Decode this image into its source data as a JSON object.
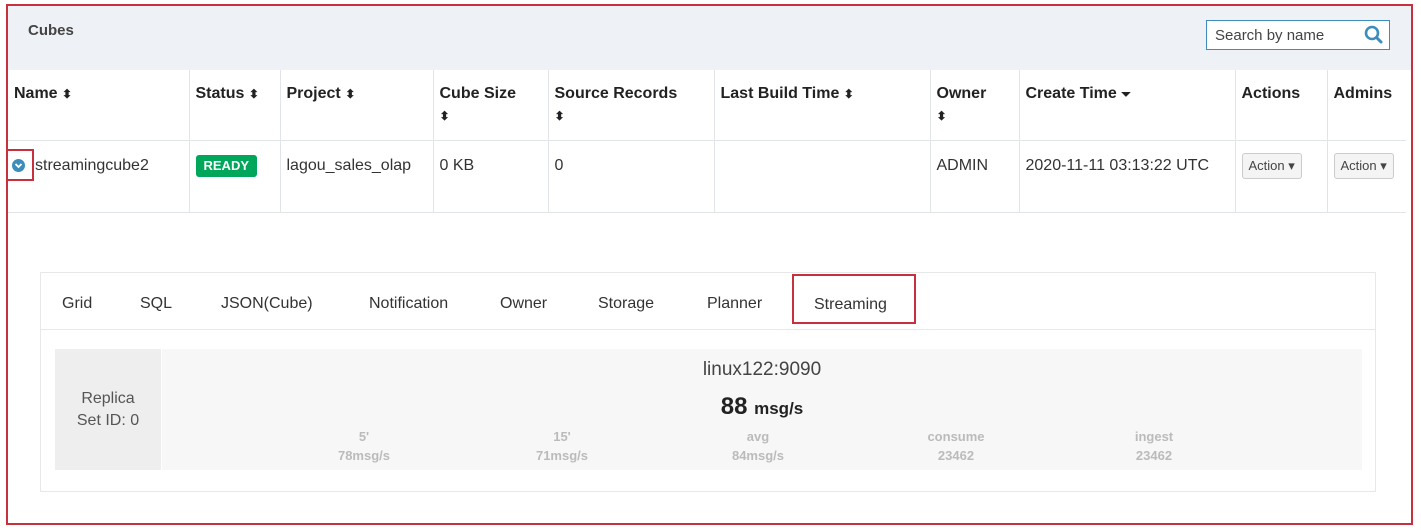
{
  "panel": {
    "title": "Cubes",
    "search_placeholder": "Search by name",
    "search_icon": "search-icon"
  },
  "table": {
    "columns": [
      {
        "label": "Name",
        "sort": "⬍"
      },
      {
        "label": "Status",
        "sort": "⬍"
      },
      {
        "label": "Project",
        "sort": "⬍"
      },
      {
        "label": "Cube Size",
        "sort": "⬍"
      },
      {
        "label": "Source Records",
        "sort": "⬍"
      },
      {
        "label": "Last Build Time",
        "sort": "⬍"
      },
      {
        "label": "Owner",
        "sort": "⬍"
      },
      {
        "label": "Create Time",
        "sort": "⏷"
      },
      {
        "label": "Actions",
        "sort": ""
      },
      {
        "label": "Admins",
        "sort": ""
      }
    ],
    "rows": [
      {
        "name": "streamingcube2",
        "status": "READY",
        "project": "lagou_sales_olap",
        "cube_size": "0 KB",
        "source_records": "0",
        "last_build_time": "",
        "owner": "ADMIN",
        "create_time": "2020-11-11 03:13:22 UTC",
        "action_label": "Action ▾",
        "admin_action_label": "Action ▾"
      }
    ]
  },
  "detail": {
    "tabs": [
      "Grid",
      "SQL",
      "JSON(Cube)",
      "Notification",
      "Owner",
      "Storage",
      "Planner",
      "Streaming"
    ],
    "active_tab": "Streaming",
    "replica_label": "Replica Set ID: 0",
    "server": "linux122:9090",
    "rate_value": "88",
    "rate_unit": "msg/s",
    "stats": [
      {
        "label": "5'",
        "value": "78msg/s"
      },
      {
        "label": "15'",
        "value": "71msg/s"
      },
      {
        "label": "avg",
        "value": "84msg/s"
      },
      {
        "label": "consume",
        "value": "23462"
      },
      {
        "label": "ingest",
        "value": "23462"
      }
    ]
  },
  "colors": {
    "highlight_border": "#c9303e",
    "status_ready": "#00a65a",
    "accent": "#3c8dbc"
  }
}
